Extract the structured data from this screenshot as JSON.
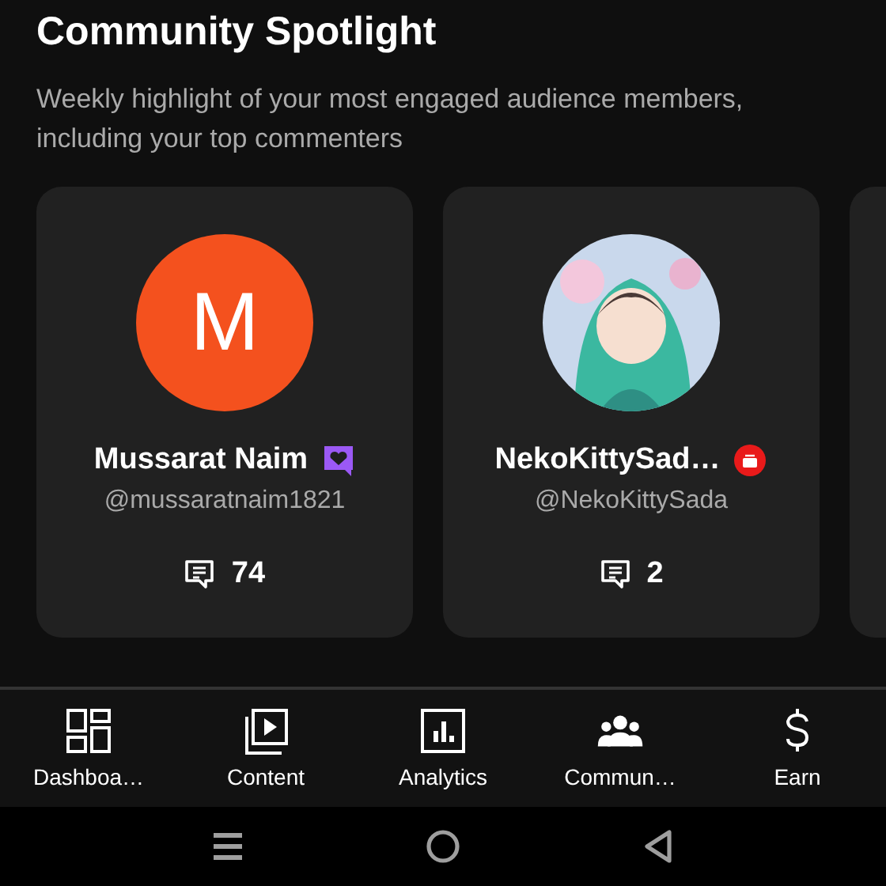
{
  "header": {
    "title": "Community Spotlight",
    "subtitle": "Weekly highlight of your most engaged audience members, including your top commenters"
  },
  "cards": [
    {
      "avatar": {
        "kind": "letter",
        "letter": "M",
        "color": "#f4511e"
      },
      "name": "Mussarat Naim",
      "badge": {
        "kind": "member"
      },
      "handle": "@mussaratnaim1821",
      "comments": "74"
    },
    {
      "name": "NekoKittySad…",
      "badge": {
        "kind": "live"
      },
      "handle": "@NekoKittySada",
      "comments": "2"
    }
  ],
  "nav": [
    {
      "kind": "dashboard",
      "label": "Dashboa…"
    },
    {
      "kind": "content",
      "label": "Content"
    },
    {
      "kind": "analytics",
      "label": "Analytics"
    },
    {
      "kind": "community",
      "label": "Commun…"
    },
    {
      "kind": "earn",
      "label": "Earn"
    }
  ]
}
